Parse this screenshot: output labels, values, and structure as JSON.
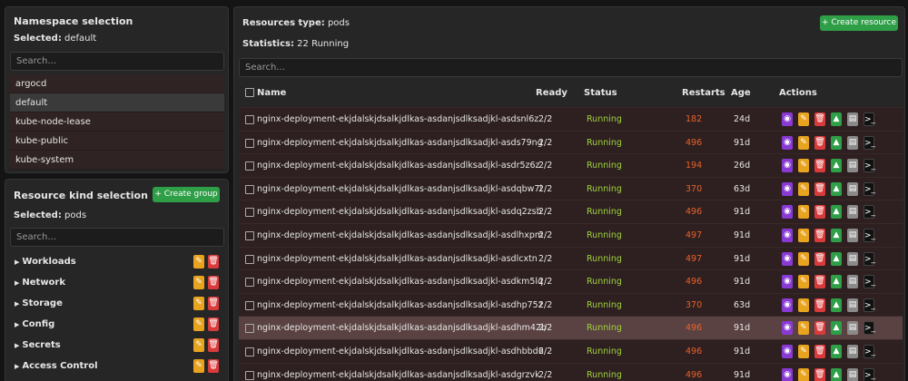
{
  "namespace": {
    "title": "Namespace selection",
    "selected_label": "Selected:",
    "selected_value": "default",
    "search_placeholder": "Search...",
    "items": [
      "argocd",
      "default",
      "kube-node-lease",
      "kube-public",
      "kube-system"
    ]
  },
  "kind": {
    "title": "Resource kind selection",
    "create_group": "+ Create group",
    "selected_label": "Selected:",
    "selected_value": "pods",
    "search_placeholder": "Search...",
    "groups": [
      "Workloads",
      "Network",
      "Storage",
      "Config",
      "Secrets",
      "Access Control"
    ]
  },
  "resources": {
    "type_label": "Resources type:",
    "type_value": "pods",
    "stats_label": "Statistics:",
    "stats_value": "22 Running",
    "create_resource": "+ Create resource",
    "search_placeholder": "Search...",
    "columns": [
      "Name",
      "Ready",
      "Status",
      "Restarts",
      "Age",
      "Actions"
    ],
    "rows": [
      {
        "name": "nginx-deployment-ekjdalskjdsalkjdlkas-asdanjsdlksadjkl-asdsnl6z",
        "ready": "2/2",
        "status": "Running",
        "restarts": "182",
        "age": "24d"
      },
      {
        "name": "nginx-deployment-ekjdalskjdsalkjdlkas-asdanjsdlksadjkl-asds79ng",
        "ready": "2/2",
        "status": "Running",
        "restarts": "496",
        "age": "91d"
      },
      {
        "name": "nginx-deployment-ekjdalskjdsalkjdlkas-asdanjsdlksadjkl-asdr5z6z",
        "ready": "2/2",
        "status": "Running",
        "restarts": "194",
        "age": "26d"
      },
      {
        "name": "nginx-deployment-ekjdalskjdsalkjdlkas-asdanjsdlksadjkl-asdqbw7l",
        "ready": "2/2",
        "status": "Running",
        "restarts": "370",
        "age": "63d"
      },
      {
        "name": "nginx-deployment-ekjdalskjdsalkjdlkas-asdanjsdlksadjkl-asdq2zsb",
        "ready": "2/2",
        "status": "Running",
        "restarts": "496",
        "age": "91d"
      },
      {
        "name": "nginx-deployment-ekjdalskjdsalkjdlkas-asdanjsdlksadjkl-asdlhxpm",
        "ready": "2/2",
        "status": "Running",
        "restarts": "497",
        "age": "91d"
      },
      {
        "name": "nginx-deployment-ekjdalskjdsalkjdlkas-asdanjsdlksadjkl-asdlcxtn",
        "ready": "2/2",
        "status": "Running",
        "restarts": "497",
        "age": "91d"
      },
      {
        "name": "nginx-deployment-ekjdalskjdsalkjdlkas-asdanjsdlksadjkl-asdkm5lq",
        "ready": "2/2",
        "status": "Running",
        "restarts": "496",
        "age": "91d"
      },
      {
        "name": "nginx-deployment-ekjdalskjdsalkjdlkas-asdanjsdlksadjkl-asdhp75z",
        "ready": "2/2",
        "status": "Running",
        "restarts": "370",
        "age": "63d"
      },
      {
        "name": "nginx-deployment-ekjdalskjdsalkjdlkas-asdanjsdlksadjkl-asdhm42b",
        "ready": "2/2",
        "status": "Running",
        "restarts": "496",
        "age": "91d"
      },
      {
        "name": "nginx-deployment-ekjdalskjdsalkjdlkas-asdanjsdlksadjkl-asdhbbd6",
        "ready": "2/2",
        "status": "Running",
        "restarts": "496",
        "age": "91d"
      },
      {
        "name": "nginx-deployment-ekjdalskjdsalkjdlkas-asdanjsdlksadjkl-asdgrzvk",
        "ready": "2/2",
        "status": "Running",
        "restarts": "496",
        "age": "91d"
      }
    ]
  },
  "icons": {
    "view": "eye-icon",
    "edit": "pencil-icon",
    "delete": "trash-icon",
    "scale": "triangle-up-icon",
    "logs": "document-icon",
    "shell": "terminal-icon"
  },
  "colors": {
    "status_running": "#9fd33e",
    "restarts": "#e8612a",
    "accent_green": "#2e9e47",
    "edit": "#e8a31f",
    "delete": "#d93b3b",
    "view": "#8a3ad4"
  }
}
